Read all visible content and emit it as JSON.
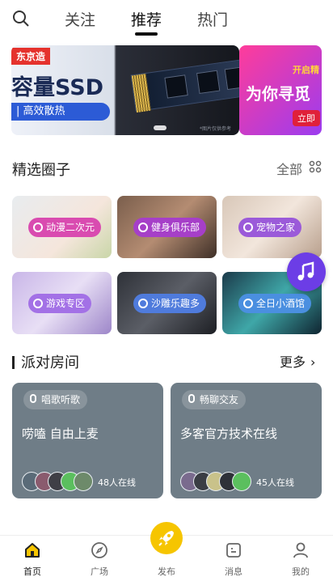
{
  "top_nav": {
    "tabs": [
      "关注",
      "推荐",
      "热门"
    ]
  },
  "banner": {
    "brand": "东京造",
    "title": "容量SSD",
    "pill": "| 高效散热",
    "note": "*图片仅供参考"
  },
  "banner2": {
    "line1": "开启精",
    "line2": "为你寻觅",
    "line3": "立即"
  },
  "circles": {
    "title": "精选圈子",
    "all_label": "全部",
    "items": [
      {
        "label": "动漫二次元",
        "tag_color": "#d94bb0"
      },
      {
        "label": "健身俱乐部",
        "tag_color": "#a63fc8"
      },
      {
        "label": "宠物之家",
        "tag_color": "#9b5ad9"
      },
      {
        "label": "游戏专区",
        "tag_color": "#a371e6"
      },
      {
        "label": "沙雕乐趣多",
        "tag_color": "#4f7bdc"
      },
      {
        "label": "全日小酒馆",
        "tag_color": "#4a8fe0"
      }
    ]
  },
  "party": {
    "title": "派对房间",
    "more_label": "更多",
    "rooms": [
      {
        "tag": "唱歌听歌",
        "title": "唠嗑 自由上麦",
        "online": "48人在线"
      },
      {
        "tag": "畅聊交友",
        "title": "多客官方技术在线",
        "online": "45人在线"
      }
    ]
  },
  "bottom_tabs": [
    "首页",
    "广场",
    "发布",
    "消息",
    "我的"
  ],
  "accent": "#f6c500",
  "music_button_color": "#6c3de6"
}
